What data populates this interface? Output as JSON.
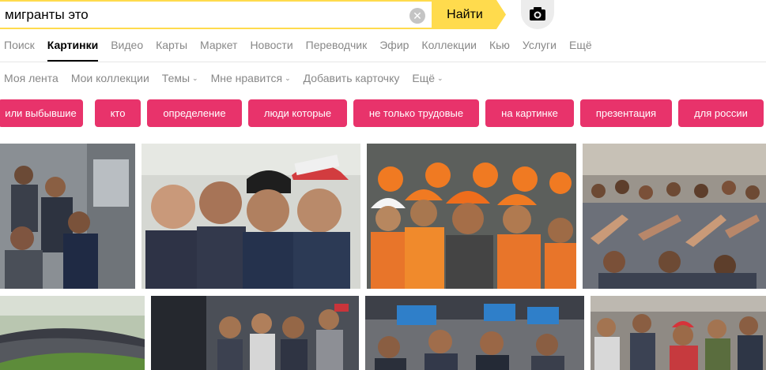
{
  "search": {
    "query": "мигранты это",
    "button_label": "Найти",
    "clear_symbol": "✕"
  },
  "services": [
    {
      "label": "Поиск",
      "active": false
    },
    {
      "label": "Картинки",
      "active": true
    },
    {
      "label": "Видео",
      "active": false
    },
    {
      "label": "Карты",
      "active": false
    },
    {
      "label": "Маркет",
      "active": false
    },
    {
      "label": "Новости",
      "active": false
    },
    {
      "label": "Переводчик",
      "active": false
    },
    {
      "label": "Эфир",
      "active": false
    },
    {
      "label": "Коллекции",
      "active": false
    },
    {
      "label": "Кью",
      "active": false
    },
    {
      "label": "Услуги",
      "active": false
    },
    {
      "label": "Ещё",
      "active": false
    }
  ],
  "subnav": [
    {
      "label": "Моя лента"
    },
    {
      "label": "Мои коллекции"
    },
    {
      "label": "Темы"
    },
    {
      "label": "Мне нравится"
    },
    {
      "label": "Добавить карточку"
    },
    {
      "label": "Ещё"
    }
  ],
  "chevron": "⌄",
  "chips": [
    {
      "label": "или выбывшие"
    },
    {
      "label": "кто"
    },
    {
      "label": "определение"
    },
    {
      "label": "люди которые"
    },
    {
      "label": "не только трудовые"
    },
    {
      "label": "на картинке"
    },
    {
      "label": "презентация"
    },
    {
      "label": "для россии"
    }
  ],
  "colors": {
    "accent_yellow": "#ffdb4d",
    "chip_pink": "#e8336b",
    "nav_gray": "#888888"
  },
  "icons": {
    "clear": "clear-icon",
    "camera": "camera-icon"
  }
}
